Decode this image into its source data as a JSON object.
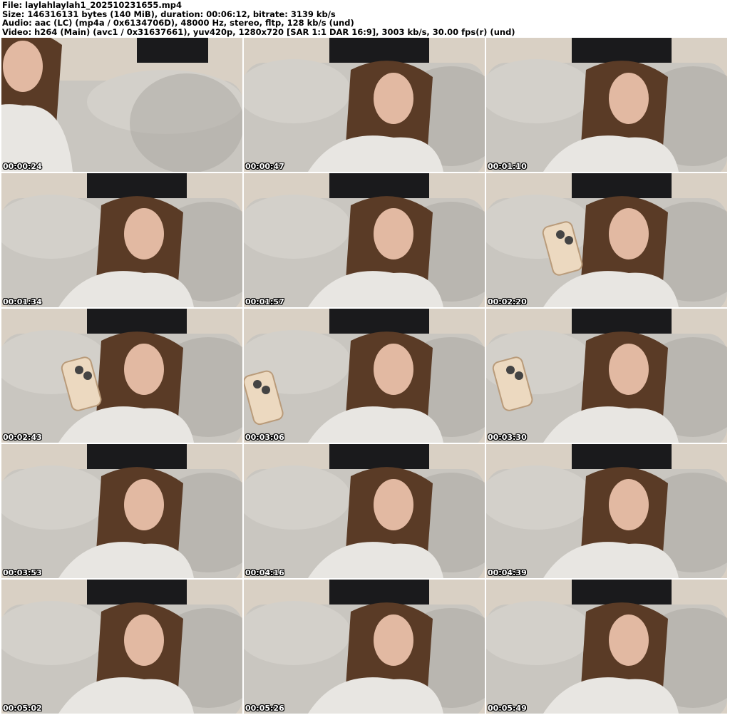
{
  "header": {
    "file_line": "File: laylahlaylah1_202510231655.mp4",
    "size_line": "Size: 146316131 bytes (140 MiB), duration: 00:06:12, bitrate: 3139 kb/s",
    "audio_line": "Audio: aac (LC) (mp4a / 0x6134706D), 48000 Hz, stereo, fltp, 128 kb/s (und)",
    "video_line": "Video: h264 (Main) (avc1 / 0x31637661), yuv420p, 1280x720 [SAR 1:1 DAR 16:9], 3003 kb/s, 30.00 fps(r) (und)"
  },
  "thumbnails": [
    {
      "timestamp": "00:00:24",
      "phone": false
    },
    {
      "timestamp": "00:00:47",
      "phone": false
    },
    {
      "timestamp": "00:01:10",
      "phone": false
    },
    {
      "timestamp": "00:01:34",
      "phone": false
    },
    {
      "timestamp": "00:01:57",
      "phone": false
    },
    {
      "timestamp": "00:02:20",
      "phone": true
    },
    {
      "timestamp": "00:02:43",
      "phone": true
    },
    {
      "timestamp": "00:03:06",
      "phone": true
    },
    {
      "timestamp": "00:03:30",
      "phone": true
    },
    {
      "timestamp": "00:03:53",
      "phone": false
    },
    {
      "timestamp": "00:04:16",
      "phone": false
    },
    {
      "timestamp": "00:04:39",
      "phone": false
    },
    {
      "timestamp": "00:05:02",
      "phone": false
    },
    {
      "timestamp": "00:05:26",
      "phone": false
    },
    {
      "timestamp": "00:05:49",
      "phone": false
    }
  ],
  "colors": {
    "wall": "#d9d0c4",
    "curtain": "#1a1a1c",
    "couch": "#c9c6c0",
    "couch_shadow": "#a9a6a0",
    "hair": "#5a3b26",
    "skin": "#e2b9a2",
    "sweater": "#e8e6e2",
    "phone_case": "#ecd9c0"
  }
}
